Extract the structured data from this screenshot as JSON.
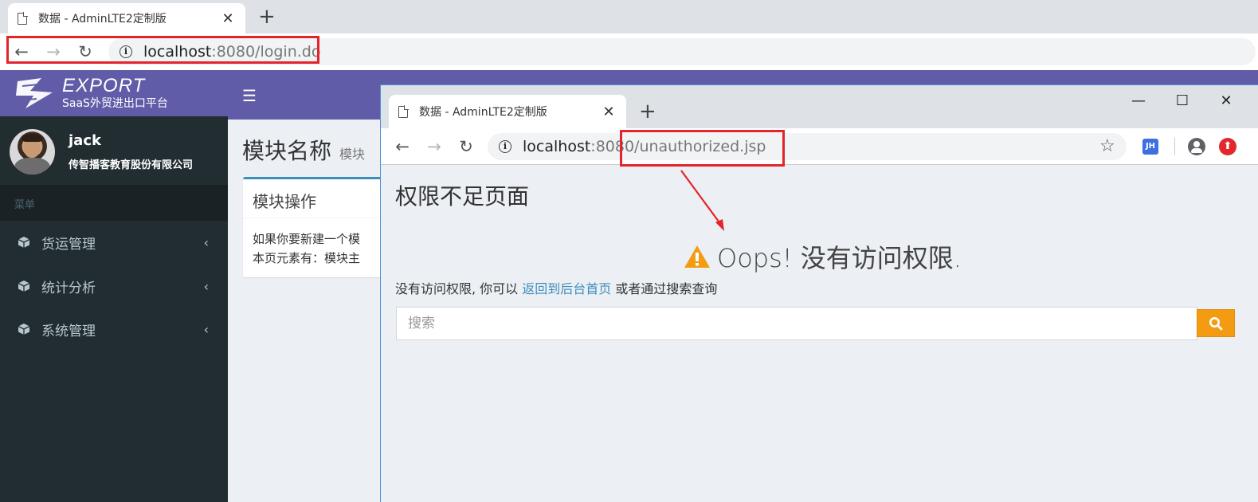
{
  "outer_browser": {
    "tab_title": "数据 - AdminLTE2定制版",
    "url_host": "localhost",
    "url_path": ":8080/login.do"
  },
  "app": {
    "brand": "EXPORT",
    "brand_subtitle": "SaaS外贸进出口平台",
    "user": {
      "name": "jack",
      "company": "传智播客教育股份有限公司"
    },
    "menu_header": "菜单",
    "menu_items": [
      {
        "label": "货运管理"
      },
      {
        "label": "统计分析"
      },
      {
        "label": "系统管理"
      }
    ],
    "content_header": {
      "title": "模块名称",
      "subtitle": "模块"
    },
    "box": {
      "title": "模块操作",
      "line1": "如果你要新建一个模",
      "line2": "本页元素有：模块主"
    }
  },
  "inner_browser": {
    "tab_title": "数据 - AdminLTE2定制版",
    "url_host": "localhost",
    "url_path": ":8080/unauthorized.jsp",
    "ext_label": "JH"
  },
  "error_page": {
    "title": "权限不足页面",
    "headline": "Oops! 没有访问权限.",
    "desc_prefix": "没有访问权限, 你可以 ",
    "link_text": "返回到后台首页",
    "desc_suffix": " 或者通过搜索查询",
    "search_placeholder": "搜索"
  },
  "colors": {
    "sidebar_bg": "#222d32",
    "header_purple": "#605ca8",
    "annotation_red": "#e3242b",
    "search_button": "#f39c12",
    "link_blue": "#3c8dbc"
  }
}
